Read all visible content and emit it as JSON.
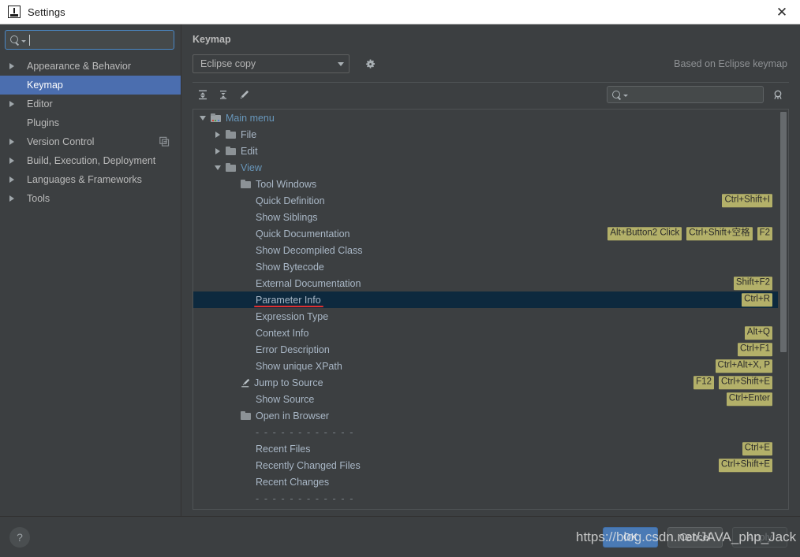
{
  "window": {
    "title": "Settings",
    "app_icon": "intellij-idea-icon",
    "close_label": "✕"
  },
  "sidebar": {
    "search": {
      "placeholder": "",
      "value": "",
      "icon": "search-icon"
    },
    "items": [
      {
        "label": "Appearance & Behavior",
        "expandable": true,
        "selected": false,
        "right_icon": null
      },
      {
        "label": "Keymap",
        "expandable": false,
        "selected": true,
        "right_icon": null
      },
      {
        "label": "Editor",
        "expandable": true,
        "selected": false,
        "right_icon": null
      },
      {
        "label": "Plugins",
        "expandable": false,
        "selected": false,
        "right_icon": null
      },
      {
        "label": "Version Control",
        "expandable": true,
        "selected": false,
        "right_icon": "copy-icon"
      },
      {
        "label": "Build, Execution, Deployment",
        "expandable": true,
        "selected": false,
        "right_icon": null
      },
      {
        "label": "Languages & Frameworks",
        "expandable": true,
        "selected": false,
        "right_icon": null
      },
      {
        "label": "Tools",
        "expandable": true,
        "selected": false,
        "right_icon": null
      }
    ]
  },
  "main": {
    "title": "Keymap",
    "keymap_select": {
      "value": "Eclipse copy",
      "options": [
        "Eclipse copy"
      ]
    },
    "gear_icon": "gear-icon",
    "based_on": "Based on Eclipse keymap",
    "toolbar": [
      {
        "name": "expand-all-icon",
        "title": "Expand All"
      },
      {
        "name": "collapse-all-icon",
        "title": "Collapse All"
      },
      {
        "name": "edit-shortcut-icon",
        "title": "Edit Shortcut"
      }
    ],
    "filter": {
      "value": "",
      "placeholder": "",
      "icon": "search-icon"
    },
    "filter_by_shortcut_icon": "find-shortcut-icon"
  },
  "tree": {
    "rows": [
      {
        "indent": 0,
        "twisty": "down",
        "icon": "main-menu-folder",
        "label": "Main menu",
        "blue": true,
        "shortcuts": []
      },
      {
        "indent": 1,
        "twisty": "right",
        "icon": "folder",
        "label": "File",
        "blue": false,
        "shortcuts": []
      },
      {
        "indent": 1,
        "twisty": "right",
        "icon": "folder",
        "label": "Edit",
        "blue": false,
        "shortcuts": []
      },
      {
        "indent": 1,
        "twisty": "down",
        "icon": "folder",
        "label": "View",
        "blue": true,
        "shortcuts": []
      },
      {
        "indent": 2,
        "twisty": "none",
        "icon": "folder",
        "label": "Tool Windows",
        "blue": false,
        "shortcuts": []
      },
      {
        "indent": 2,
        "twisty": "none",
        "icon": "none",
        "label": "Quick Definition",
        "blue": false,
        "shortcuts": [
          "Ctrl+Shift+I"
        ]
      },
      {
        "indent": 2,
        "twisty": "none",
        "icon": "none",
        "label": "Show Siblings",
        "blue": false,
        "shortcuts": []
      },
      {
        "indent": 2,
        "twisty": "none",
        "icon": "none",
        "label": "Quick Documentation",
        "blue": false,
        "shortcuts": [
          "Alt+Button2 Click",
          "Ctrl+Shift+空格",
          "F2"
        ]
      },
      {
        "indent": 2,
        "twisty": "none",
        "icon": "none",
        "label": "Show Decompiled Class",
        "blue": false,
        "shortcuts": []
      },
      {
        "indent": 2,
        "twisty": "none",
        "icon": "none",
        "label": "Show Bytecode",
        "blue": false,
        "shortcuts": []
      },
      {
        "indent": 2,
        "twisty": "none",
        "icon": "none",
        "label": "External Documentation",
        "blue": false,
        "shortcuts": [
          "Shift+F2"
        ]
      },
      {
        "indent": 2,
        "twisty": "none",
        "icon": "none",
        "label": "Parameter Info",
        "blue": false,
        "selected": true,
        "underline": true,
        "shortcuts": [
          "Ctrl+R"
        ]
      },
      {
        "indent": 2,
        "twisty": "none",
        "icon": "none",
        "label": "Expression Type",
        "blue": false,
        "shortcuts": []
      },
      {
        "indent": 2,
        "twisty": "none",
        "icon": "none",
        "label": "Context Info",
        "blue": false,
        "shortcuts": [
          "Alt+Q"
        ]
      },
      {
        "indent": 2,
        "twisty": "none",
        "icon": "none",
        "label": "Error Description",
        "blue": false,
        "shortcuts": [
          "Ctrl+F1"
        ]
      },
      {
        "indent": 2,
        "twisty": "none",
        "icon": "none",
        "label": "Show unique XPath",
        "blue": false,
        "shortcuts": [
          "Ctrl+Alt+X, P"
        ]
      },
      {
        "indent": 2,
        "twisty": "none",
        "icon": "pencil",
        "label": "Jump to Source",
        "blue": false,
        "shortcuts": [
          "F12",
          "Ctrl+Shift+E"
        ]
      },
      {
        "indent": 2,
        "twisty": "none",
        "icon": "none",
        "label": "Show Source",
        "blue": false,
        "shortcuts": [
          "Ctrl+Enter"
        ]
      },
      {
        "indent": 2,
        "twisty": "none",
        "icon": "folder",
        "label": "Open in Browser",
        "blue": false,
        "shortcuts": []
      },
      {
        "indent": 2,
        "twisty": "none",
        "icon": "none",
        "label": "- - - - - - - - - - - -",
        "separator": true,
        "blue": false,
        "shortcuts": []
      },
      {
        "indent": 2,
        "twisty": "none",
        "icon": "none",
        "label": "Recent Files",
        "blue": false,
        "shortcuts": [
          "Ctrl+E"
        ]
      },
      {
        "indent": 2,
        "twisty": "none",
        "icon": "none",
        "label": "Recently Changed Files",
        "blue": false,
        "shortcuts": [
          "Ctrl+Shift+E"
        ]
      },
      {
        "indent": 2,
        "twisty": "none",
        "icon": "none",
        "label": "Recent Changes",
        "blue": false,
        "shortcuts": []
      },
      {
        "indent": 2,
        "twisty": "none",
        "icon": "none",
        "label": "- - - - - - - - - - - -",
        "separator": true,
        "blue": false,
        "shortcuts": []
      }
    ]
  },
  "footer": {
    "help_label": "?",
    "ok_label": "OK",
    "cancel_label": "Cancel",
    "apply_label": "Apply"
  },
  "overlay": {
    "watermark": "https://blog.csdn.net/JAVA_php_Jack"
  },
  "colors": {
    "accent": "#4b6eaf",
    "selection": "#0d293e",
    "shortcut_badge": "#b3b069",
    "link": "#6897bb",
    "panel_bg": "#3c3f41",
    "annotation": "#e03030"
  }
}
